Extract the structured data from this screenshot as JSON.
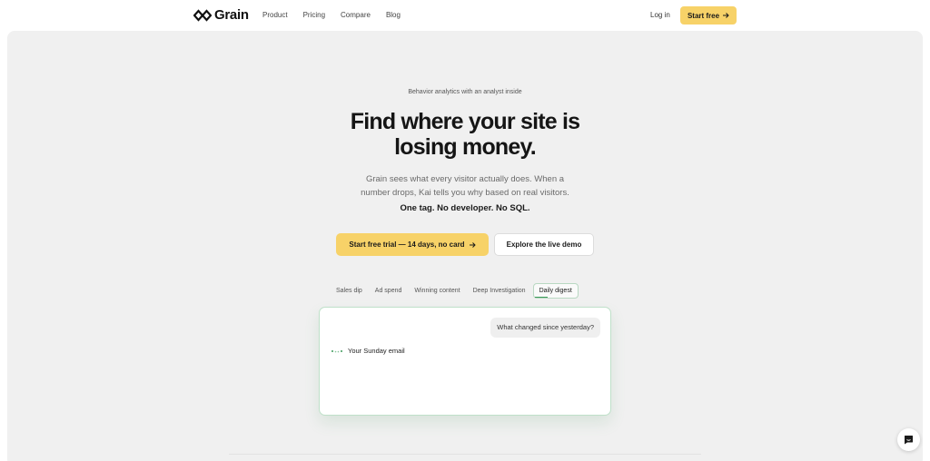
{
  "nav": {
    "brand": "Grain",
    "links": [
      "Product",
      "Pricing",
      "Compare",
      "Blog"
    ],
    "login": "Log in",
    "start_free": "Start free"
  },
  "hero": {
    "eyebrow": "Behavior analytics with an analyst inside",
    "headline_line1": "Find where your site is",
    "headline_line2": "losing money.",
    "sub_line1": "Grain sees what every visitor actually does. When a",
    "sub_line2": "number drops, Kai tells you why based on real visitors.",
    "tagline": "One tag. No developer. No SQL.",
    "cta_primary": "Start free trial — 14 days, no card",
    "cta_secondary": "Explore the live demo"
  },
  "demo": {
    "tabs": [
      "Sales dip",
      "Ad spend",
      "Winning content",
      "Deep Investigation",
      "Daily digest"
    ],
    "active_tab": "Daily digest",
    "user_message": "What changed since yesterday?",
    "assistant_message": "Your Sunday email"
  },
  "colors": {
    "accent_yellow": "#f7d268",
    "accent_green": "#3c9a5a",
    "hero_bg": "#f0f0f0"
  },
  "icons": {
    "logo": "grain-logo-icon",
    "arrow": "arrow-right-icon",
    "typing": "typing-dots-icon",
    "chat": "chat-bubble-icon"
  }
}
